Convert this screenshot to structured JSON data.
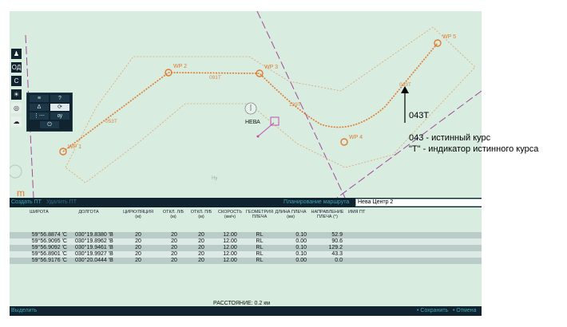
{
  "map": {
    "waypoints": [
      {
        "label": "WP 1"
      },
      {
        "label": "WP 2"
      },
      {
        "label": "WP 3"
      },
      {
        "label": "WP 4"
      },
      {
        "label": "WP 5"
      }
    ],
    "leg_labels": [
      "053T",
      "091T",
      "129T",
      "043T"
    ],
    "target_label": "НЕВА",
    "ship_icon_text": "Ну",
    "colors": {
      "route": "#e07b2e",
      "boundary": "#a04a9a",
      "water": "#d9ece0"
    }
  },
  "toolbar": {
    "buttons": [
      {
        "icon": "binoculars-icon",
        "text": "♟"
      },
      {
        "icon": "oa-icon",
        "text": "ОД"
      },
      {
        "icon": "c-icon",
        "text": "С"
      },
      {
        "icon": "sun-icon",
        "text": "☀"
      },
      {
        "icon": "compass-icon",
        "text": "◎"
      },
      {
        "icon": "cloud-icon",
        "text": "☁"
      }
    ],
    "popup_buttons": [
      "≡",
      "?",
      "Δ",
      "⟳",
      "⋮⋯",
      "ѹ",
      "⏻"
    ]
  },
  "panel": {
    "create_label": "Создать ПТ",
    "delete_label": "Удалить ПТ",
    "planning_label": "Планирование маршрута",
    "route_name": "Нева Центр 2",
    "columns": [
      {
        "label": "ШИРОТА"
      },
      {
        "label": "ДОЛГОТА"
      },
      {
        "label": "ЦИРКУЛЯЦИЯ",
        "unit": "(м)"
      },
      {
        "label": "ОТКЛ. Л/Б",
        "unit": "(м)"
      },
      {
        "label": "ОТКЛ. П/Б",
        "unit": "(м)"
      },
      {
        "label": "СКОРОСТЬ",
        "unit": "(км/ч)"
      },
      {
        "label": "ГЕОМЕТРИЯ",
        "unit": "ПЛЕЧА"
      },
      {
        "label": "ДЛИНА ПЛЕЧА",
        "unit": "(км)"
      },
      {
        "label": "НАПРАВЛЕНИЕ",
        "unit": "ПЛЕЧА (°)"
      },
      {
        "label": "ИМЯ ПТ"
      }
    ],
    "rows": [
      [
        "59°56.8874 'С",
        "030°19.8380 'В",
        "20",
        "20",
        "20",
        "12.00",
        "RL",
        "0.10",
        "52.9"
      ],
      [
        "59°56.9095 'С",
        "030°19.8962 'В",
        "20",
        "20",
        "20",
        "12.00",
        "RL",
        "0.00",
        "90.6"
      ],
      [
        "59°56.9092 'С",
        "030°19.9461 'В",
        "20",
        "20",
        "20",
        "12.00",
        "RL",
        "0.10",
        "129.2"
      ],
      [
        "59°56.8901 'С",
        "030°19.9927 'В",
        "20",
        "20",
        "20",
        "12.00",
        "RL",
        "0.10",
        "43.3"
      ],
      [
        "59°56.9176 'С",
        "030°20.0444 'В",
        "20",
        "20",
        "20",
        "12.00",
        "RL",
        "0.00",
        "0.0"
      ]
    ],
    "distance": "РАССТОЯНИЕ: 0.2 км",
    "select_label": "Выделить",
    "save_label": "Сохранить",
    "cancel_label": "Отмена"
  },
  "annotation": {
    "heading": "043T",
    "line1": "043 - истинный курс",
    "line2": "\"T\" - индикатор истинного курса"
  }
}
